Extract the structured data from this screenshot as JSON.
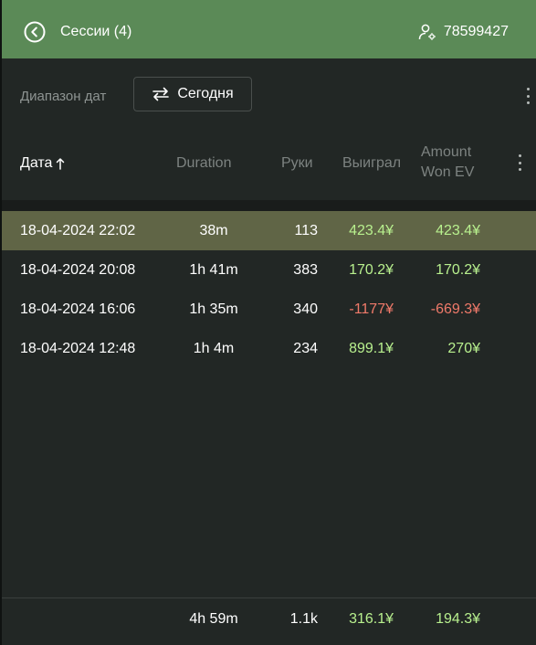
{
  "header": {
    "title": "Сессии (4)",
    "user_id": "78599427",
    "back_icon": "back-circle-icon",
    "user_icon": "user-settings-icon"
  },
  "filter": {
    "label": "Диапазон дат",
    "button_label": "Сегодня",
    "button_icon": "swap-arrows-icon"
  },
  "table": {
    "columns": [
      "Дата",
      "Duration",
      "Руки",
      "Выиграл",
      "Amount Won EV"
    ],
    "sort": {
      "column": "Дата",
      "direction": "asc",
      "icon": "arrow-up-icon"
    },
    "rows": [
      {
        "date": "18-04-2024 22:02",
        "duration": "38m",
        "hands": "113",
        "won": "423.4¥",
        "won_ev": "423.4¥"
      },
      {
        "date": "18-04-2024 20:08",
        "duration": "1h 41m",
        "hands": "383",
        "won": "170.2¥",
        "won_ev": "170.2¥"
      },
      {
        "date": "18-04-2024 16:06",
        "duration": "1h 35m",
        "hands": "340",
        "won": "-1177¥",
        "won_ev": "-669.3¥"
      },
      {
        "date": "18-04-2024 12:48",
        "duration": "1h 4m",
        "hands": "234",
        "won": "899.1¥",
        "won_ev": "270¥"
      }
    ],
    "selected_row": 0
  },
  "totals": {
    "duration": "4h 59m",
    "hands": "1.1k",
    "won": "316.1¥",
    "won_ev": "194.3¥"
  },
  "colors": {
    "header_bg": "#5b8a57",
    "app_bg": "#222725",
    "selected_row_bg": "#606546",
    "positive": "#b8f08e",
    "negative": "#f07a6a"
  }
}
